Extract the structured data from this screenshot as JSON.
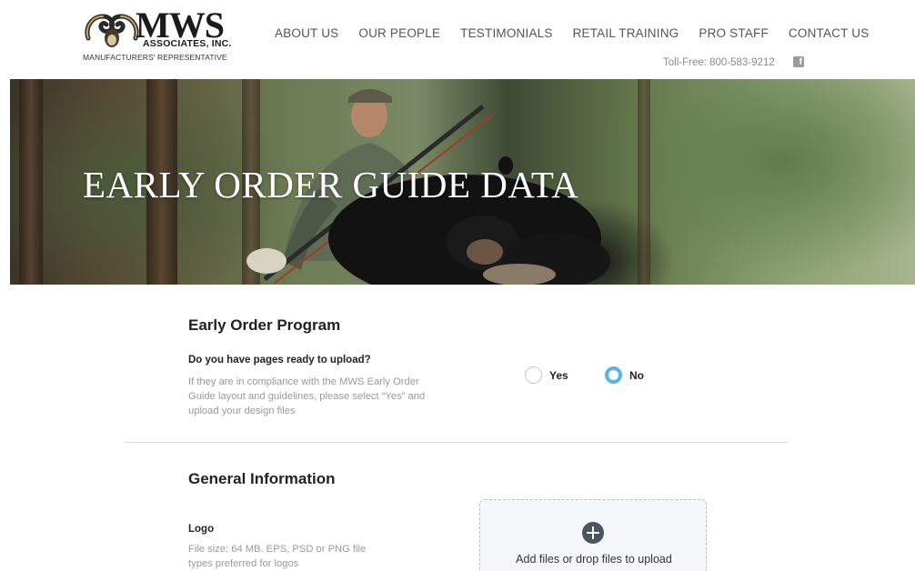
{
  "header": {
    "logo": {
      "name": "MWS",
      "sub": "ASSOCIATES, INC.",
      "tagline": "MANUFACTURERS' REPRESENTATIVE",
      "icon": "ram-horns-logo"
    },
    "nav": [
      {
        "label": "ABOUT US"
      },
      {
        "label": "OUR PEOPLE"
      },
      {
        "label": "TESTIMONIALS"
      },
      {
        "label": "RETAIL TRAINING"
      },
      {
        "label": "PRO STAFF"
      },
      {
        "label": "CONTACT US"
      }
    ],
    "toll_free": "Toll-Free: 800-583-9212",
    "social_icon": "facebook-icon"
  },
  "hero": {
    "title": "EARLY ORDER GUIDE DATA"
  },
  "early_order": {
    "title": "Early Order Program",
    "question": "Do you have pages ready to upload?",
    "help": "If they are in compliance with the MWS Early Order Guide layout and guidelines, please select “Yes” and upload your design files",
    "options": [
      {
        "label": "Yes",
        "selected": false
      },
      {
        "label": "No",
        "selected": true
      }
    ]
  },
  "general_info": {
    "title": "General Information",
    "logo_label": "Logo",
    "logo_help": "File size: 64 MB. EPS, PSD or PNG file types preferred for logos",
    "dropzone_text": "Add files or drop files to upload",
    "dropzone_icon": "plus-circle-icon"
  },
  "colors": {
    "radio_selected": "#5bb2e8",
    "help_text": "#9a9a9a",
    "dropzone_bg": "#f4f8fb"
  }
}
